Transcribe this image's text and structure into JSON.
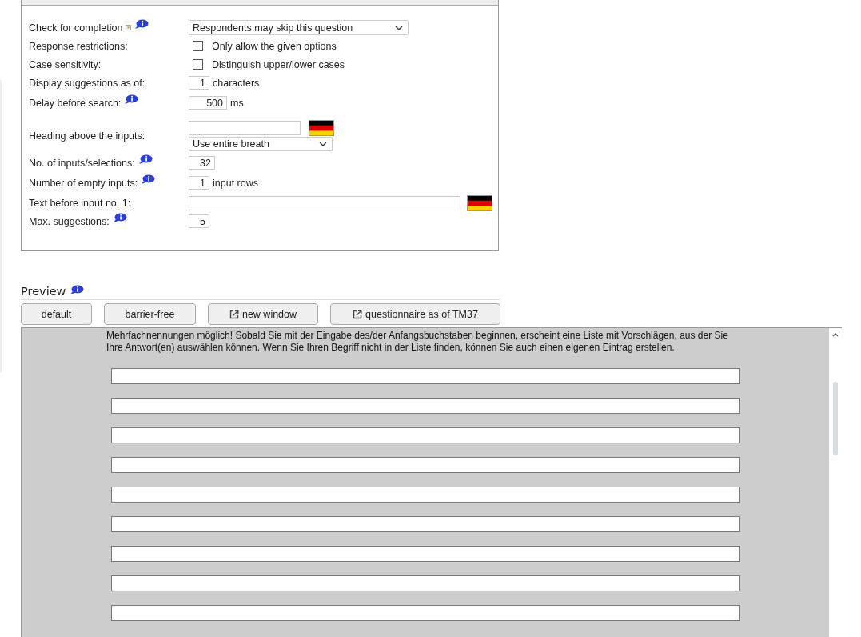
{
  "settings": {
    "rows": [
      {
        "kind": "select",
        "label": "Check for completion",
        "marked": true,
        "value": "Respondents may skip this question",
        "info": true
      },
      {
        "kind": "checkbox",
        "label": "Response restrictions:",
        "text": "Only allow the given options",
        "checked": false
      },
      {
        "kind": "checkbox",
        "label": "Case sensitivity:",
        "text": "Distinguish upper/lower cases",
        "checked": false
      },
      {
        "kind": "number",
        "label": "Display suggestions as of:",
        "value": "1",
        "unit": "characters"
      },
      {
        "kind": "number",
        "label": "Delay before search:",
        "info": true,
        "value": "500",
        "unit": "ms"
      },
      {
        "kind": "heading",
        "label": "Heading above the inputs:",
        "value": "Use entire breath"
      },
      {
        "kind": "number",
        "label": "No. of inputs/selections:",
        "info": true,
        "value": "32"
      },
      {
        "kind": "number",
        "label": "Number of empty inputs:",
        "info": true,
        "value": "1",
        "unit": "input rows"
      },
      {
        "kind": "text",
        "label": "Text before input no. 1:"
      },
      {
        "kind": "number",
        "label": "Max. suggestions:",
        "info": true,
        "value": "5"
      }
    ]
  },
  "preview": {
    "title": "Preview",
    "info": true,
    "buttons": [
      {
        "label": "default",
        "kind": "plain"
      },
      {
        "label": "barrier-free",
        "kind": "plain"
      },
      {
        "label": "new window",
        "kind": "external"
      },
      {
        "label": "questionnaire as of TM37",
        "kind": "external"
      }
    ],
    "question": "Mehrfachnennungen möglich! Sobald Sie mit der Eingabe des/der Anfangsbuchstaben beginnen, erscheint eine Liste mit Vorschlägen, aus der Sie Ihre Antwort(en) auswählen können. Wenn Sie Ihren Begriff nicht in der Liste finden, können Sie auch einen eigenen Eintrag erstellen."
  }
}
